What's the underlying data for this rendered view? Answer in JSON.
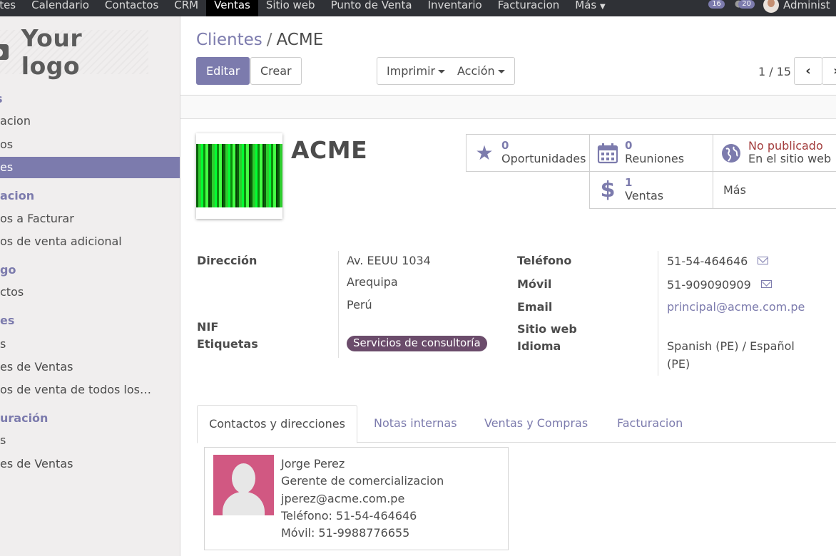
{
  "topbar": {
    "menu": [
      {
        "label": "ates",
        "active": false
      },
      {
        "label": "Calendario",
        "active": false
      },
      {
        "label": "Contactos",
        "active": false
      },
      {
        "label": "CRM",
        "active": false
      },
      {
        "label": "Ventas",
        "active": true
      },
      {
        "label": "Sitio web",
        "active": false
      },
      {
        "label": "Punto de Venta",
        "active": false
      },
      {
        "label": "Inventario",
        "active": false
      },
      {
        "label": "Facturacion",
        "active": false
      }
    ],
    "more_label": "Más",
    "notifications_count": "16",
    "messages_count": "20",
    "user_name": "Administ"
  },
  "sidebar": {
    "logo_text": "Your logo",
    "items": [
      {
        "type": "head",
        "label": "s"
      },
      {
        "type": "item",
        "label": "acion"
      },
      {
        "type": "item",
        "label": "os"
      },
      {
        "type": "item",
        "label": "es",
        "active": true
      },
      {
        "type": "head",
        "label": "acion"
      },
      {
        "type": "item",
        "label": "os a Facturar"
      },
      {
        "type": "item",
        "label": "os de venta adicional"
      },
      {
        "type": "head",
        "label": "go"
      },
      {
        "type": "item",
        "label": "ctos"
      },
      {
        "type": "head",
        "label": "es"
      },
      {
        "type": "item",
        "label": "s"
      },
      {
        "type": "item",
        "label": "es de Ventas"
      },
      {
        "type": "item",
        "label": "os de venta de todos los…"
      },
      {
        "type": "head",
        "label": "uración"
      },
      {
        "type": "item",
        "label": "s"
      },
      {
        "type": "item",
        "label": "es de Ventas"
      }
    ]
  },
  "control_panel": {
    "breadcrumb_parent": "Clientes",
    "breadcrumb_sep": "/",
    "breadcrumb_current": "ACME",
    "edit_label": "Editar",
    "create_label": "Crear",
    "print_label": "Imprimir",
    "action_label": "Acción",
    "pager": "1 / 15"
  },
  "partner": {
    "name": "ACME",
    "stats": {
      "opportunities": {
        "num": "0",
        "label": "Oportunidades"
      },
      "meetings": {
        "num": "0",
        "label": "Reuniones"
      },
      "website": {
        "status": "No publicado",
        "label": "En el sitio web"
      },
      "sales": {
        "num": "1",
        "label": "Ventas"
      },
      "more": "Más"
    },
    "labels": {
      "address": "Dirección",
      "nif": "NIF",
      "tags": "Etiquetas",
      "phone": "Teléfono",
      "mobile": "Móvil",
      "email": "Email",
      "website": "Sitio web",
      "language": "Idioma"
    },
    "address_lines": [
      "Av. EEUU 1034",
      "Arequipa",
      "Perú"
    ],
    "tag": "Servicios de consultoría",
    "phone": "51-54-464646",
    "mobile": "51-909090909",
    "email": "principal@acme.com.pe",
    "language_line1": "Spanish (PE) / Español",
    "language_line2": "(PE)"
  },
  "tabs": [
    {
      "label": "Contactos y direcciones",
      "active": true
    },
    {
      "label": "Notas internas",
      "active": false
    },
    {
      "label": "Ventas y Compras",
      "active": false
    },
    {
      "label": "Facturacion",
      "active": false
    }
  ],
  "contact": {
    "name": "Jorge Perez",
    "title": "Gerente de comercializacion",
    "email": "jperez@acme.com.pe",
    "phone": "Teléfono: 51-54-464646",
    "mobile": "Móvil: 51-9988776655"
  },
  "colors": {
    "accent": "#7c7bad",
    "navbar": "#2f3136",
    "tag": "#6b4c6b",
    "unpublished": "#a33d3d"
  }
}
